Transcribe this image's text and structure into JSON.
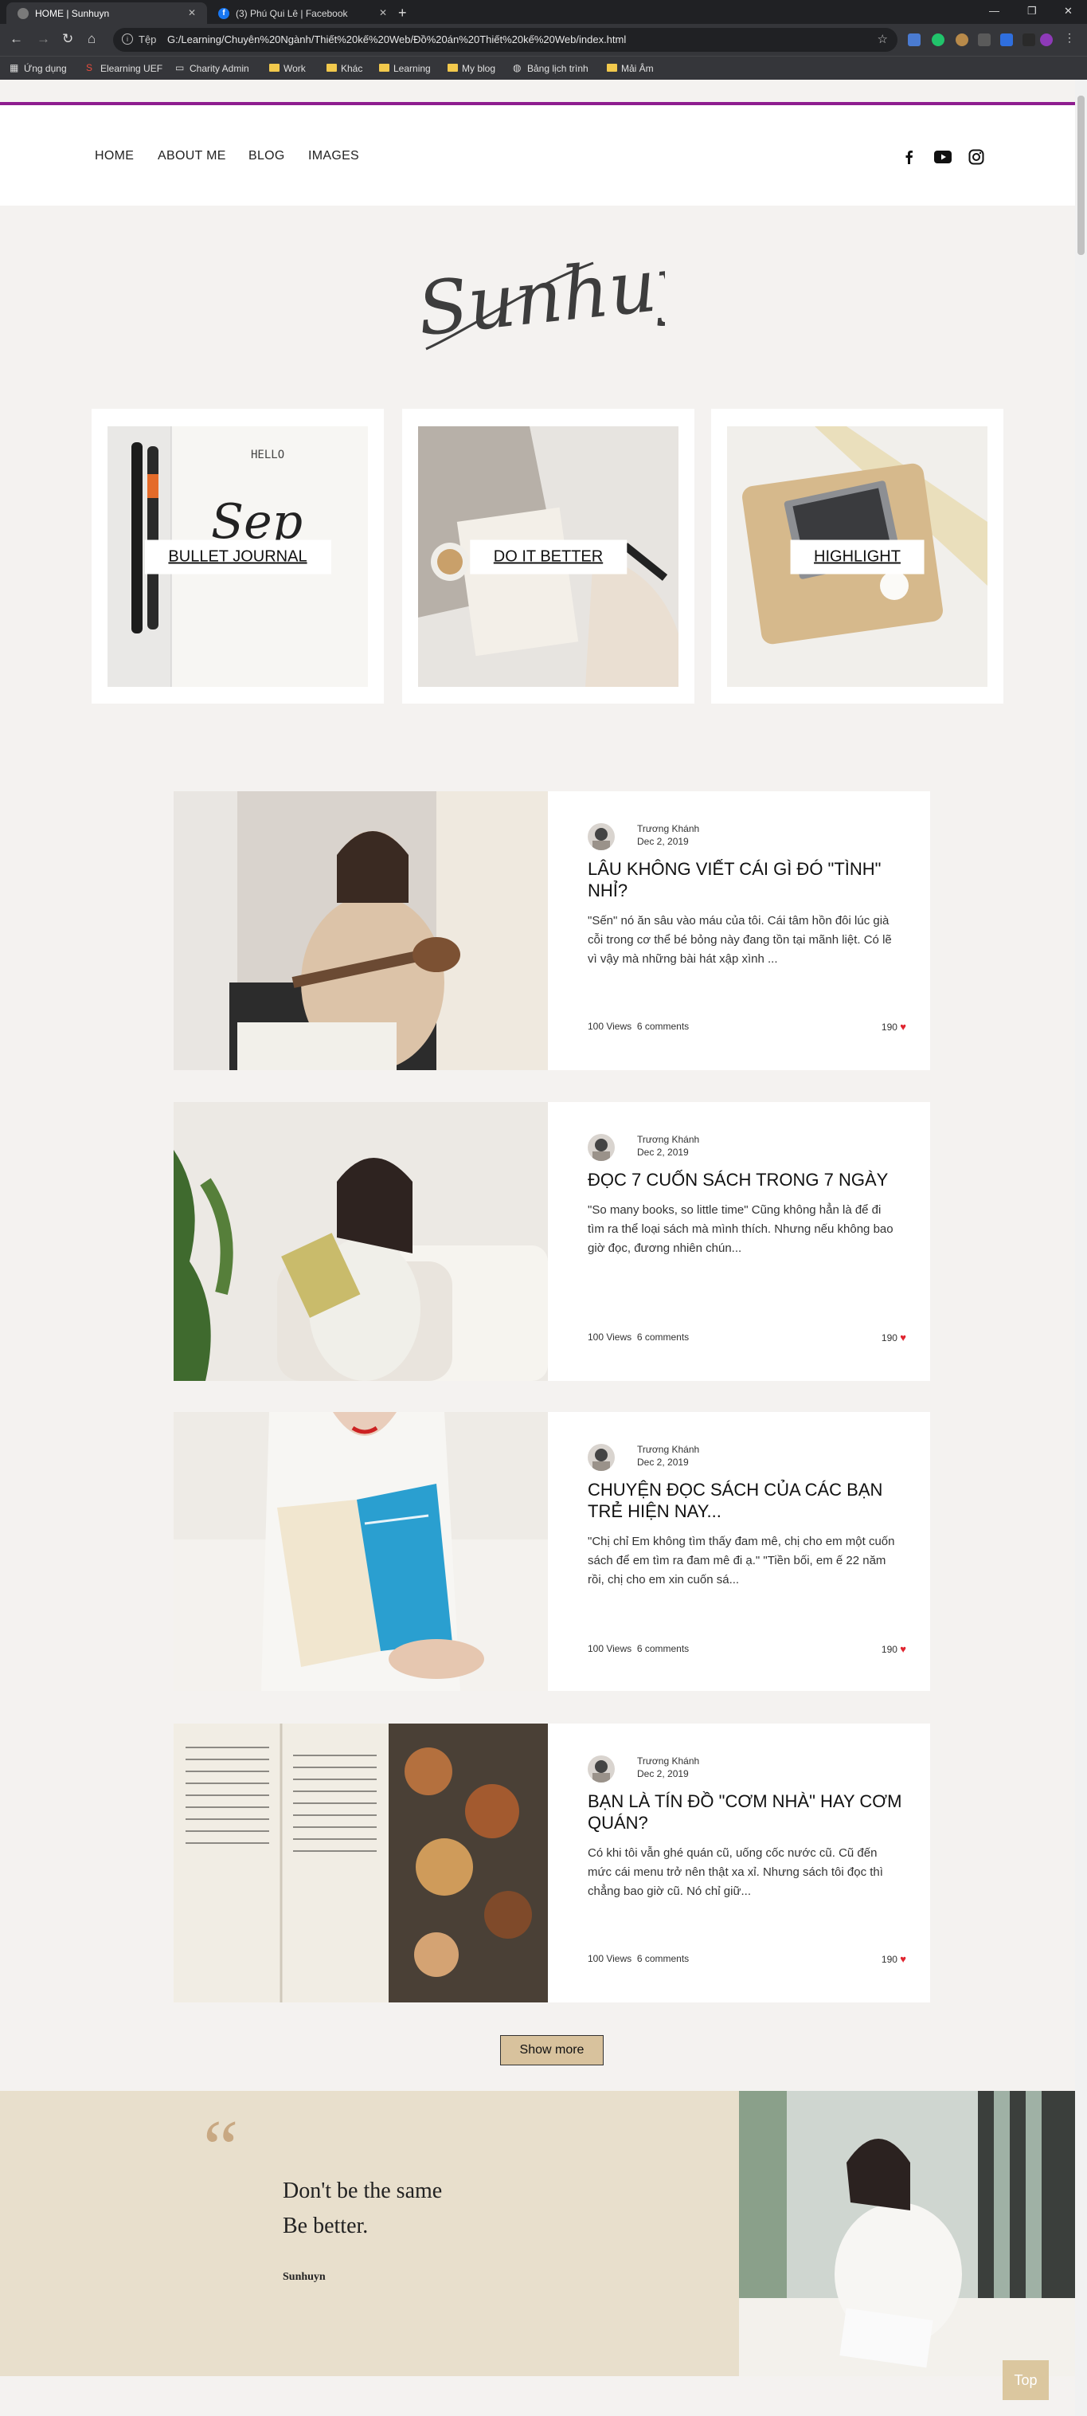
{
  "browser": {
    "tabs": [
      {
        "title": "HOME | Sunhuyn",
        "active": true
      },
      {
        "title": "(3) Phú Qui Lê | Facebook",
        "active": false
      }
    ],
    "address_prefix": "Tệp",
    "url": "G:/Learning/Chuyên%20Ngành/Thiết%20kế%20Web/Đồ%20án%20Thiết%20kế%20Web/index.html",
    "bookmarks": [
      "Ứng dụng",
      "Elearning UEF",
      "Charity Admin",
      "Work",
      "Khác",
      "Learning",
      "My blog",
      "Bảng lịch trình",
      "Mải Âm"
    ]
  },
  "nav": {
    "items": [
      "HOME",
      "ABOUT ME",
      "BLOG",
      "IMAGES"
    ],
    "social_icons": [
      "facebook-icon",
      "youtube-icon",
      "instagram-icon"
    ]
  },
  "logo_text": "Sunhuyn",
  "features": [
    {
      "label": "BULLET JOURNAL"
    },
    {
      "label": "DO IT BETTER"
    },
    {
      "label": "HIGHLIGHT"
    }
  ],
  "posts": [
    {
      "author": "Trương Khánh",
      "date": "Dec 2, 2019",
      "title": "LÂU KHÔNG VIẾT CÁI GÌ ĐÓ \"TÌNH\" NHỈ?",
      "excerpt": "\"Sến\" nó ăn sâu vào máu của tôi. Cái tâm hồn đôi lúc già cỗi trong cơ thể bé bỏng này đang tồn tại mãnh liệt. Có lẽ vì vậy mà những bài hát xập xình ...",
      "views": "100 Views",
      "comments": "6 comments",
      "likes": "190"
    },
    {
      "author": "Trương Khánh",
      "date": "Dec 2, 2019",
      "title": "ĐỌC 7 CUỐN SÁCH TRONG 7 NGÀY",
      "excerpt": "\"So many books, so little time\" Cũng không hẳn là để đi tìm ra thể loại sách mà mình thích. Nhưng nếu không bao giờ đọc, đương nhiên chún...",
      "views": "100 Views",
      "comments": "6 comments",
      "likes": "190"
    },
    {
      "author": "Trương Khánh",
      "date": "Dec 2, 2019",
      "title": "CHUYỆN ĐỌC SÁCH CỦA CÁC BẠN TRẺ HIỆN NAY...",
      "excerpt": "\"Chị chỉ Em không tìm thấy đam mê, chị cho em một cuốn sách để em tìm ra đam mê đi ạ.\" \"Tiền bối, em ế 22 năm rồi, chị cho em xin cuốn sá...",
      "views": "100 Views",
      "comments": "6 comments",
      "likes": "190"
    },
    {
      "author": "Trương Khánh",
      "date": "Dec 2, 2019",
      "title": "BẠN LÀ TÍN ĐỒ \"CƠM NHÀ\" HAY CƠM QUÁN?",
      "excerpt": "Có khi tôi vẫn ghé quán cũ, uống cốc nước cũ. Cũ đến mức cái menu trở nên thật xa xỉ. Nhưng sách tôi đọc thì chẳng bao giờ cũ. Nó chỉ giữ...",
      "views": "100 Views",
      "comments": "6 comments",
      "likes": "190"
    }
  ],
  "show_more_label": "Show more",
  "quote": {
    "mark": "“",
    "line1": "Don't be the same",
    "line2": "Be better.",
    "author": "Sunhuyn"
  },
  "top_button_label": "Top",
  "colors": {
    "accent_line": "#8e1d8f",
    "page_bg": "#f4f2f0",
    "quote_bg": "#e8dfcc",
    "button_bg": "#d8c29d",
    "heart": "#e0242f"
  }
}
